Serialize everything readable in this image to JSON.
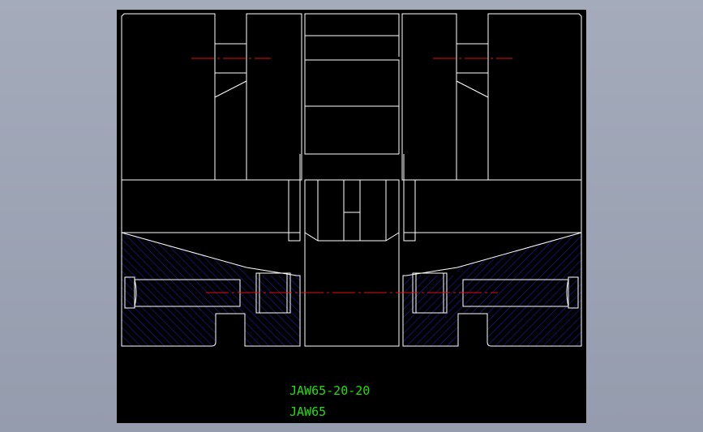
{
  "drawing": {
    "part_number": "JAW65-20-20",
    "part_code": "JAW65"
  },
  "colors": {
    "viewer_background": "#9ca3b4",
    "canvas": "#000000",
    "outline": "#ffffff",
    "hatch": "#1c1ca8",
    "centerline": "#e01010",
    "text": "#22e000"
  }
}
